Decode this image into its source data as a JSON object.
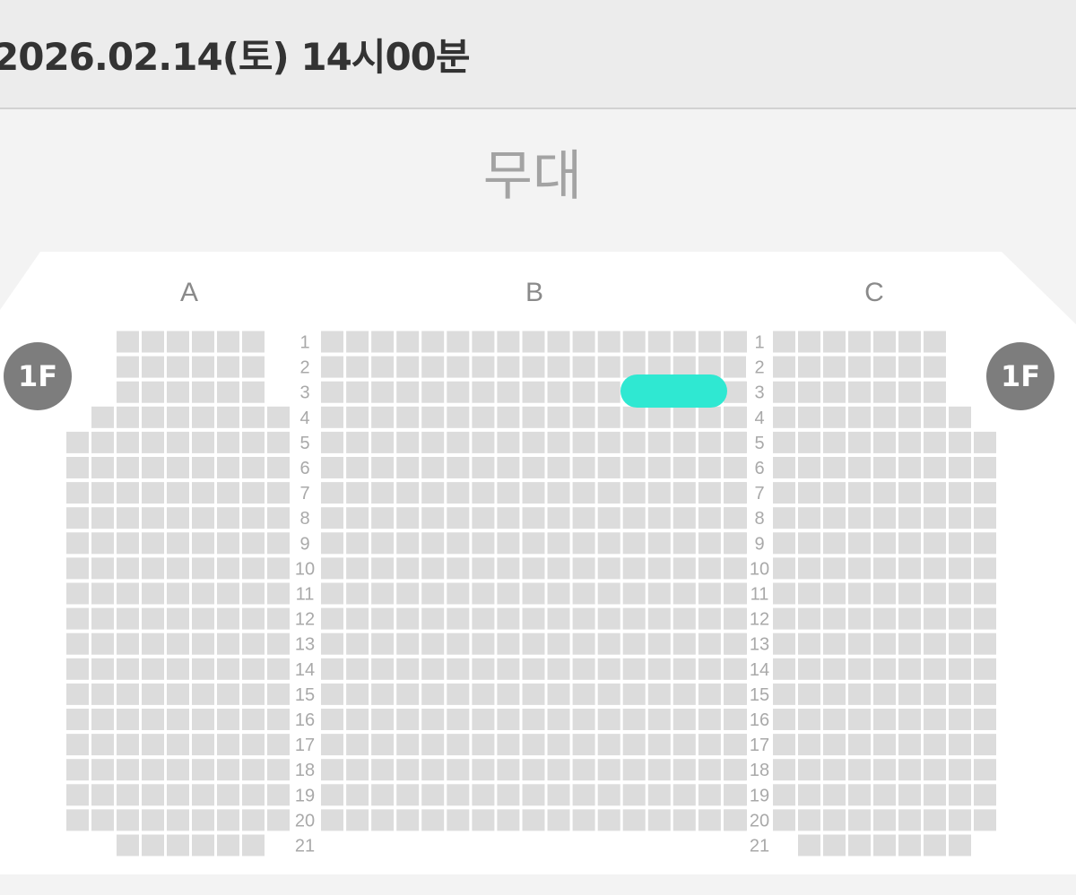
{
  "header": {
    "datetime": "2026.02.14(토) 14시00분"
  },
  "stage": {
    "label": "무대"
  },
  "floor": {
    "left_badge": "1F",
    "right_badge": "1F"
  },
  "sections": [
    {
      "id": "A",
      "label": "A"
    },
    {
      "id": "B",
      "label": "B"
    },
    {
      "id": "C",
      "label": "C"
    }
  ],
  "row_labels": [
    "1",
    "2",
    "3",
    "4",
    "5",
    "6",
    "7",
    "8",
    "9",
    "10",
    "11",
    "12",
    "13",
    "14",
    "15",
    "16",
    "17",
    "18",
    "19",
    "20",
    "21"
  ],
  "selected_seat": {
    "section": "B",
    "row": "3"
  },
  "colors": {
    "seat_available": "#dcdcdc",
    "seat_selected": "#2fe8d2",
    "badge": "#7d7d7d",
    "background": "#f3f3f3",
    "map_area": "#ffffff"
  }
}
